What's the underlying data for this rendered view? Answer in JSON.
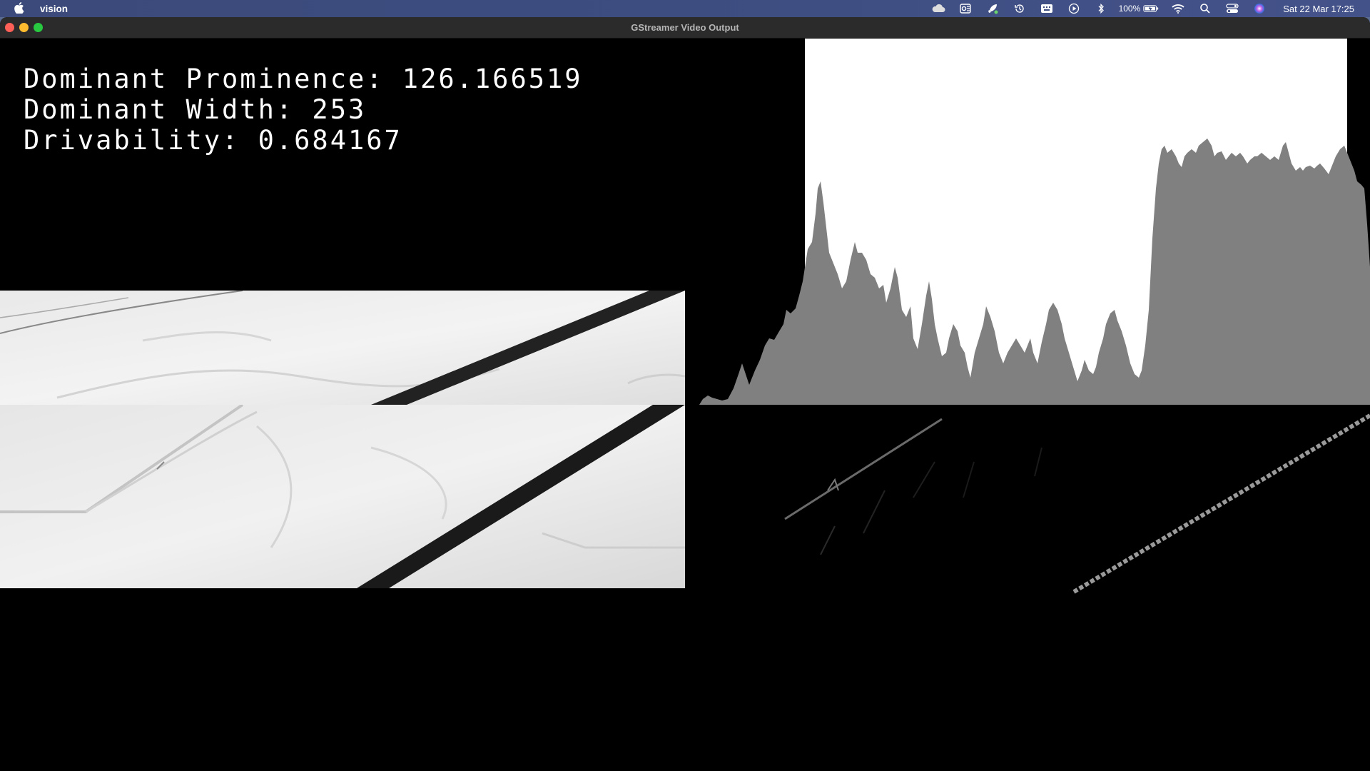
{
  "menubar": {
    "app_name": "vision",
    "battery": "100%",
    "datetime": "Sat 22 Mar  17:25",
    "icons": [
      "apple-icon",
      "cloud-icon",
      "outlook-icon",
      "rocket-icon",
      "time-machine-icon",
      "keyboard-icon",
      "play-icon",
      "bluetooth-icon",
      "battery-icon",
      "wifi-icon",
      "search-icon",
      "control-center-icon",
      "siri-icon"
    ]
  },
  "window": {
    "title": "GStreamer Video Output"
  },
  "overlay": {
    "prominence": "Dominant Prominence: 126.166519",
    "width": "Dominant Width: 253",
    "drivability": "Drivability: 0.684167"
  },
  "colors": {
    "histogram_bg": "#ffffff",
    "histogram_fill": "#808080",
    "video_bg": "#000000"
  }
}
